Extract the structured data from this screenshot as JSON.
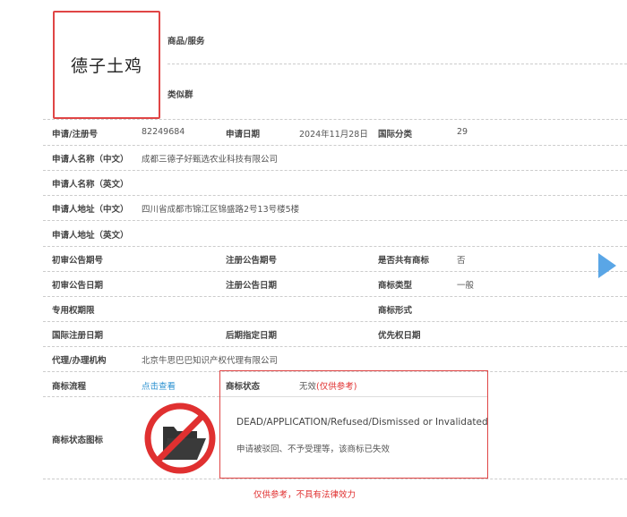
{
  "trademark": {
    "name": "德子土鸡"
  },
  "top": {
    "goods_label": "商品/服务",
    "similar_label": "类似群"
  },
  "rows": {
    "reg_no_label": "申请/注册号",
    "reg_no": "82249684",
    "app_date_label": "申请日期",
    "app_date": "2024年11月28日",
    "intl_class_label": "国际分类",
    "intl_class": "29",
    "applicant_cn_label": "申请人名称（中文）",
    "applicant_cn": "成都三德子好甄选农业科技有限公司",
    "applicant_en_label": "申请人名称（英文）",
    "address_cn_label": "申请人地址（中文）",
    "address_cn": "四川省成都市锦江区锦盛路2号13号楼5楼",
    "address_en_label": "申请人地址（英文）",
    "prelim_no_label": "初审公告期号",
    "reg_pub_no_label": "注册公告期号",
    "shared_label": "是否共有商标",
    "shared": "否",
    "prelim_date_label": "初审公告日期",
    "reg_pub_date_label": "注册公告日期",
    "type_label": "商标类型",
    "type": "一般",
    "exclusive_label": "专用权期限",
    "form_label": "商标形式",
    "intl_reg_date_label": "国际注册日期",
    "later_date_label": "后期指定日期",
    "priority_label": "优先权日期",
    "agent_label": "代理/办理机构",
    "agent": "北京牛思巴巴知识产权代理有限公司",
    "process_label": "商标流程",
    "process_link": "点击查看",
    "status_label": "商标状态",
    "status": "无效",
    "status_note": "(仅供参考)",
    "status_icon_label": "商标状态图标",
    "status_en": "DEAD/APPLICATION/Refused/Dismissed or Invalidated",
    "status_cn": "申请被驳回、不予受理等，该商标已失效"
  },
  "disclaimer": "仅供参考，不具有法律效力",
  "colors": {
    "accent_red": "#e04545",
    "link": "#2a90d0",
    "arrow": "#5aa6e6"
  }
}
